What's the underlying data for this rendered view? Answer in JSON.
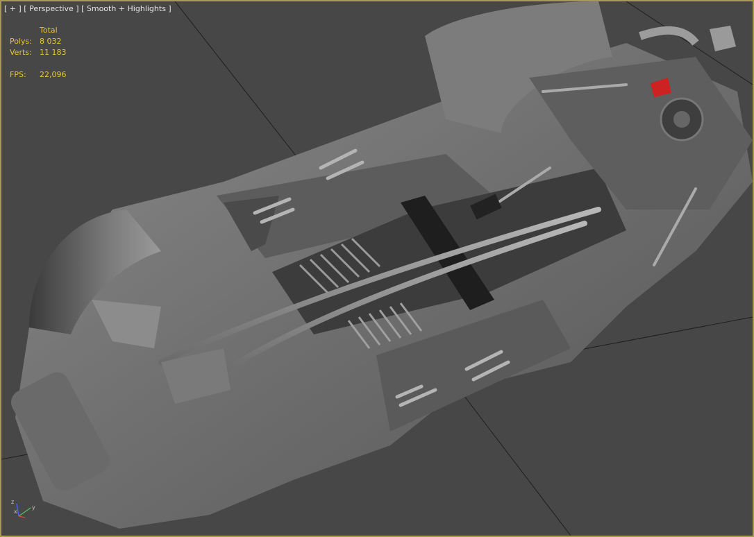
{
  "viewport": {
    "label_parts": [
      "[ + ]",
      "[ Perspective ]",
      "[ Smooth + Highlights ]"
    ],
    "stats": {
      "header": "Total",
      "rows": [
        {
          "key": "Polys:",
          "value": "8 032"
        },
        {
          "key": "Verts:",
          "value": "11 183"
        }
      ],
      "fps_key": "FPS:",
      "fps_value": "22,096"
    },
    "axis": {
      "x": "x",
      "y": "y",
      "z": "z"
    }
  },
  "colors": {
    "frame_border": "#a89a52",
    "background": "#474747",
    "stats_text": "#e6c832",
    "label_text": "#e4e4e4",
    "highlight_part": "#cc2222"
  }
}
